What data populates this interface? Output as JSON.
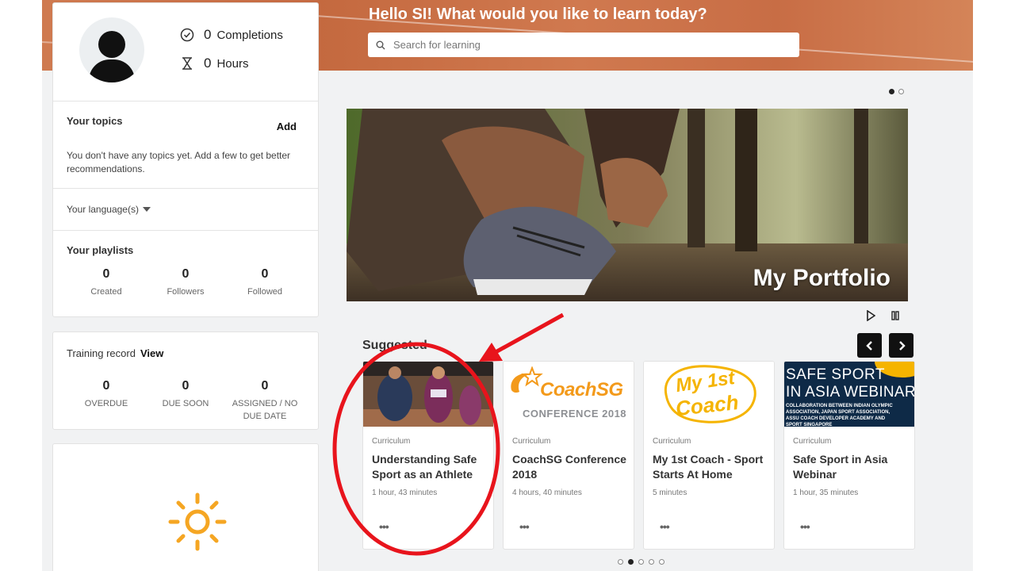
{
  "header": {
    "greeting": "Hello SI! What would you like to learn today?",
    "search_placeholder": "Search for learning"
  },
  "profile": {
    "completions_count": "0",
    "completions_label": "Completions",
    "hours_count": "0",
    "hours_label": "Hours"
  },
  "topics": {
    "title": "Your topics",
    "add_label": "Add",
    "empty_text": "You don't have any topics yet. Add a few to get better recommendations."
  },
  "language": {
    "label": "Your language(s)"
  },
  "playlists": {
    "title": "Your playlists",
    "items": [
      {
        "value": "0",
        "label": "Created"
      },
      {
        "value": "0",
        "label": "Followers"
      },
      {
        "value": "0",
        "label": "Followed"
      }
    ]
  },
  "training": {
    "title": "Training record",
    "view_label": "View",
    "items": [
      {
        "value": "0",
        "label": "OVERDUE"
      },
      {
        "value": "0",
        "label": "DUE SOON"
      },
      {
        "value": "0",
        "label": "ASSIGNED / NO DUE DATE"
      }
    ]
  },
  "hero": {
    "title": "My Portfolio"
  },
  "suggested": {
    "title": "Suggested",
    "tiles": [
      {
        "type": "Curriculum",
        "title": "Understanding Safe Sport as an Athlete",
        "duration": "1 hour, 43 minutes"
      },
      {
        "type": "Curriculum",
        "title": "CoachSG Conference 2018",
        "duration": "4 hours, 40 minutes",
        "thumb_line1": "CoachSG",
        "thumb_line2": "CONFERENCE 2018"
      },
      {
        "type": "Curriculum",
        "title": "My 1st Coach - Sport Starts At Home",
        "duration": "5 minutes",
        "thumb_line1": "My 1st",
        "thumb_line2": "Coach"
      },
      {
        "type": "Curriculum",
        "title": "Safe Sport in Asia Webinar",
        "duration": "1 hour, 35 minutes",
        "thumb_line1": "SAFE SPORT",
        "thumb_line2": "IN ASIA WEBINAR",
        "thumb_small": "COLLABORATION BETWEEN INDIAN OLYMPIC ASSOCIATION, JAPAN SPORT ASSOCIATION, ASSU COACH DEVELOPER ACADEMY AND SPORT SINGAPORE"
      }
    ]
  },
  "colors": {
    "banner": "#c8704a",
    "annotation_red": "#e8141c",
    "sun": "#f5a623"
  }
}
